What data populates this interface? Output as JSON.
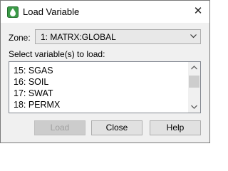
{
  "window": {
    "title": "Load Variable",
    "close_glyph": "✕"
  },
  "zone": {
    "label": "Zone:",
    "selected": "1: MATRX:GLOBAL"
  },
  "variables": {
    "label": "Select variable(s) to load:",
    "items": [
      {
        "label": "15: SGAS"
      },
      {
        "label": "16: SOIL"
      },
      {
        "label": "17: SWAT"
      },
      {
        "label": "18: PERMX"
      }
    ]
  },
  "buttons": {
    "load": "Load",
    "close": "Close",
    "help": "Help"
  },
  "icons": {
    "app": "droplet-icon",
    "close": "close-icon",
    "dropdown": "chevron-down-icon",
    "scroll_up": "chevron-up-icon",
    "scroll_down": "chevron-down-icon"
  },
  "colors": {
    "app_icon": "#2e8b3a",
    "disabled_text": "#a0a0a0"
  }
}
